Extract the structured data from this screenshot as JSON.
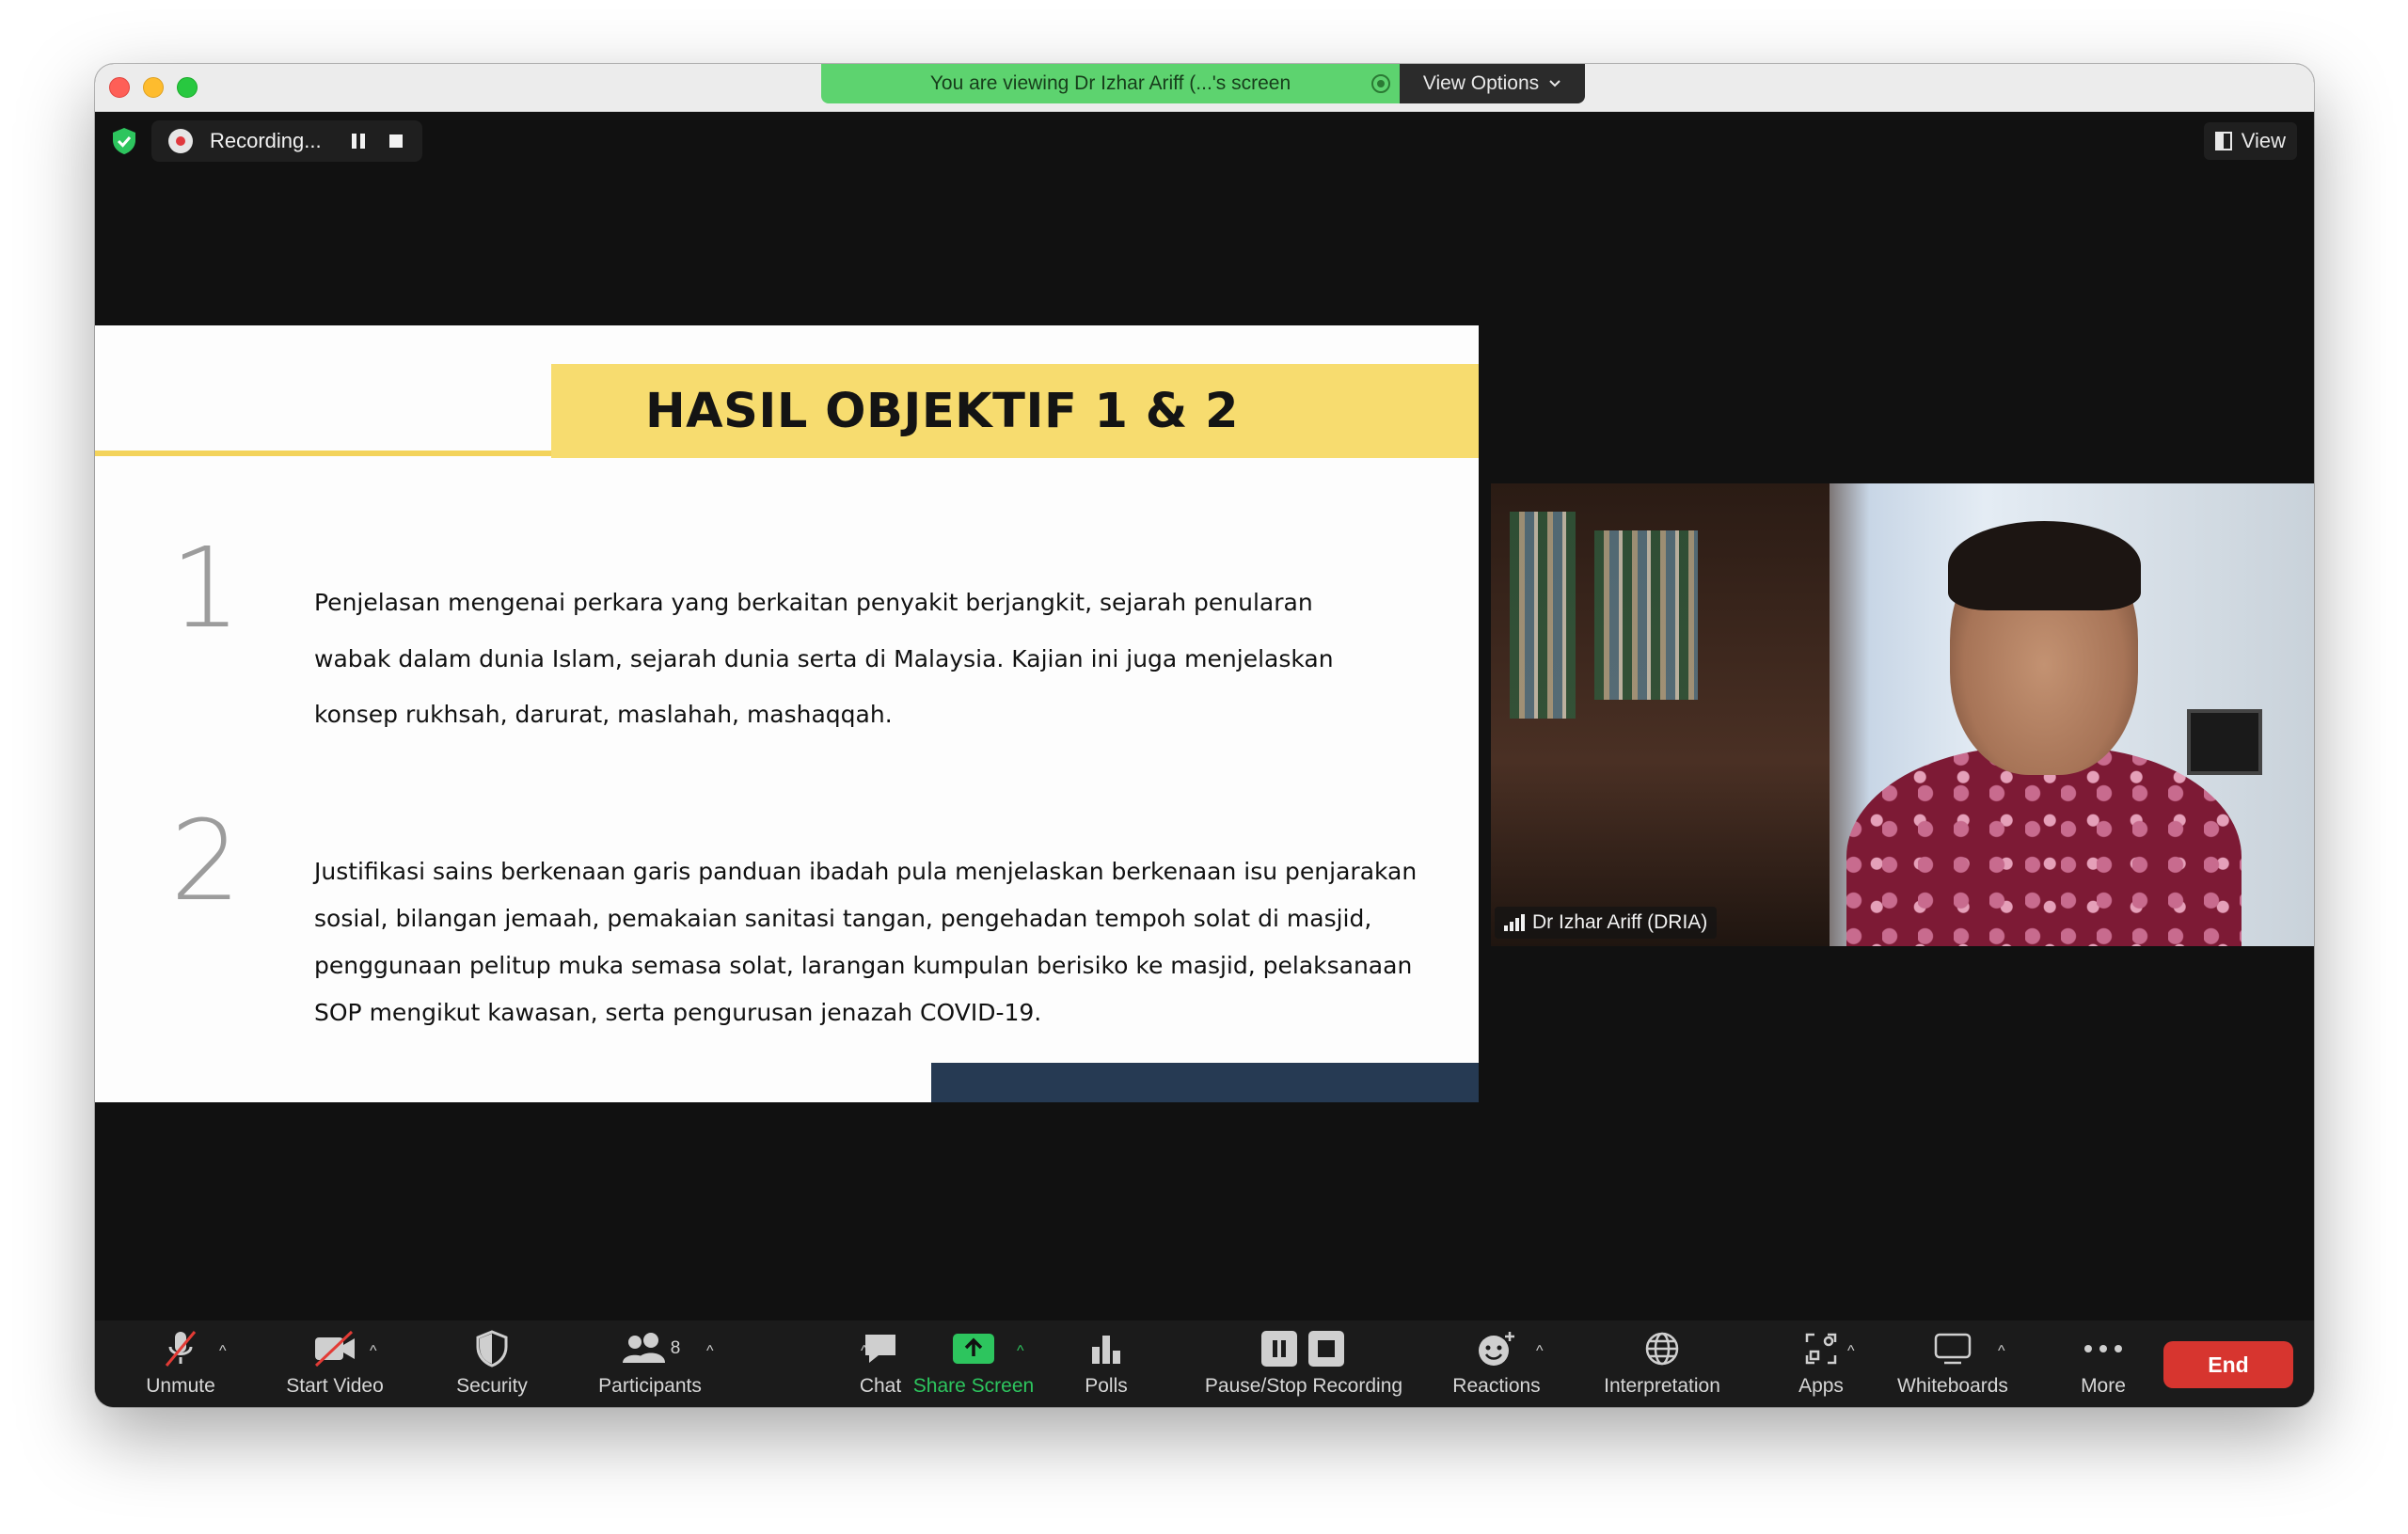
{
  "banner": {
    "viewing_text": "You are viewing Dr Izhar Ariff  (...'s screen",
    "view_options": "View Options"
  },
  "recording": {
    "label": "Recording..."
  },
  "view_button": {
    "label": "View"
  },
  "slide": {
    "title": "HASIL OBJEKTIF 1 & 2",
    "items": [
      {
        "num": "1",
        "text": "Penjelasan mengenai perkara yang berkaitan penyakit berjangkit, sejarah penularan wabak dalam dunia Islam, sejarah dunia serta di Malaysia. Kajian ini juga menjelaskan konsep rukhsah, darurat, maslahah, mashaqqah."
      },
      {
        "num": "2",
        "text": "Justifikasi sains berkenaan garis panduan ibadah pula menjelaskan berkenaan isu penjarakan sosial, bilangan jemaah, pemakaian sanitasi tangan, pengehadan tempoh solat di masjid, penggunaan pelitup muka semasa solat, larangan kumpulan berisiko ke masjid, pelaksanaan SOP mengikut kawasan, serta pengurusan jenazah COVID-19."
      }
    ]
  },
  "speaker": {
    "name": "Dr Izhar Ariff  (DRIA)"
  },
  "toolbar": {
    "unmute": "Unmute",
    "start_video": "Start Video",
    "security": "Security",
    "participants": "Participants",
    "participants_count": "8",
    "chat": "Chat",
    "share_screen": "Share Screen",
    "polls": "Polls",
    "pause_stop_recording": "Pause/Stop Recording",
    "reactions": "Reactions",
    "interpretation": "Interpretation",
    "apps": "Apps",
    "whiteboards": "Whiteboards",
    "more": "More",
    "end": "End"
  },
  "colors": {
    "banner_green": "#5dd36f",
    "slide_accent_yellow": "#f7dc6f",
    "slide_footer_navy": "#263a53",
    "end_red": "#d7352f",
    "share_green": "#2dc55e"
  }
}
